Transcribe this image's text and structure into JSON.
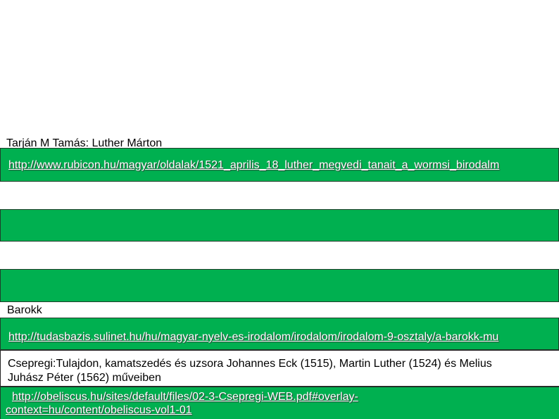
{
  "sections": {
    "luther_title": "Tarján M Tamás: Luther Márton",
    "luther_link": "http://www.rubicon.hu/magyar/oldalak/1521_aprilis_18_luther_megvedi_tanait_a_wormsi_birodalm",
    "barokk_title": "Barokk",
    "barokk_link": "http://tudasbazis.sulinet.hu/hu/magyar-nyelv-es-irodalom/irodalom/irodalom-9-osztaly/a-barokk-mu",
    "csepregi_line1": "Csepregi:Tulajdon, kamatszedés és uzsora Johannes Eck (1515), Martin Luther (1524) és Melius",
    "csepregi_line2": "Juhász Péter (1562) műveiben",
    "csepregi_link_line1": "http://obeliscus.hu/sites/default/files/02-3-Csepregi-WEB.pdf#overlay-",
    "csepregi_link_line2": "context=hu/content/obeliscus-vol1-01"
  },
  "colors": {
    "accent_green": "#00b050",
    "link_text": "#ffffff"
  }
}
